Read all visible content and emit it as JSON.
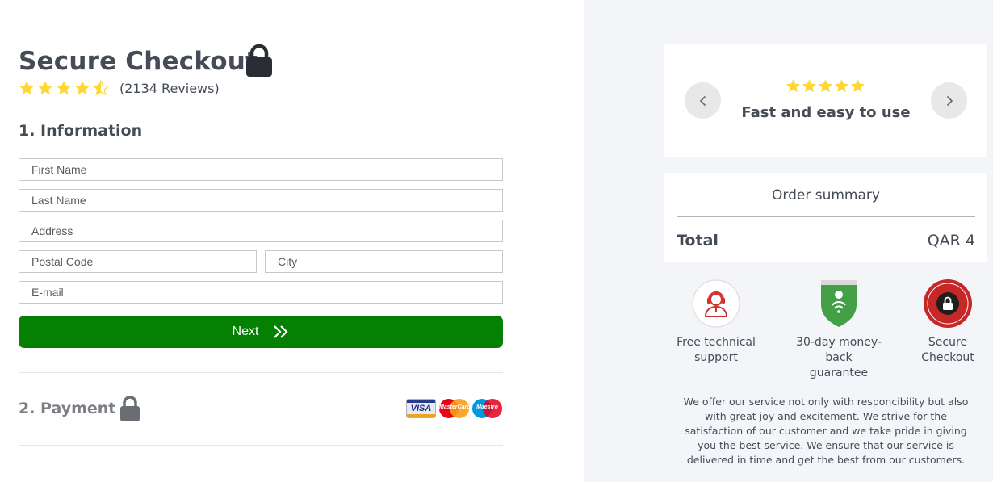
{
  "checkout": {
    "title": "Secure Checkout",
    "rating": 4.5,
    "rating_max": 5,
    "reviews_label": "(2134 Reviews)",
    "star_color": "#fdd835"
  },
  "information": {
    "section_title": "1. Information",
    "first_name_placeholder": "First Name",
    "last_name_placeholder": "Last Name",
    "address_placeholder": "Address",
    "postal_code_placeholder": "Postal Code",
    "city_placeholder": "City",
    "email_placeholder": "E-mail",
    "next_label": "Next",
    "next_color": "#048103"
  },
  "payment": {
    "section_title": "2. Payment",
    "cards": [
      {
        "name": "visa-card-icon",
        "label": "VISA"
      },
      {
        "name": "mastercard-icon",
        "label": "MasterCard"
      },
      {
        "name": "maestro-card-icon",
        "label": "Maestro"
      }
    ]
  },
  "testimonial": {
    "stars": 5,
    "text": "Fast and easy to use"
  },
  "summary": {
    "title": "Order summary",
    "total_label": "Total",
    "total_value": "QAR 4"
  },
  "badges": [
    {
      "icon": "support-agent-icon",
      "label_line1": "Free technical",
      "label_line2": "support"
    },
    {
      "icon": "money-back-shield-icon",
      "label_line1": "30-day money-back",
      "label_line2": "guarantee"
    },
    {
      "icon": "secure-checkout-seal-icon",
      "label_line1": "Secure",
      "label_line2": "Checkout"
    }
  ],
  "blurb": "We offer our service not only with responcibility but also with great joy and excitement. We strive for the satisfaction of our customer and we take pride in giving you the best service. We ensure that our service is delivered in time and get the best from our customers."
}
